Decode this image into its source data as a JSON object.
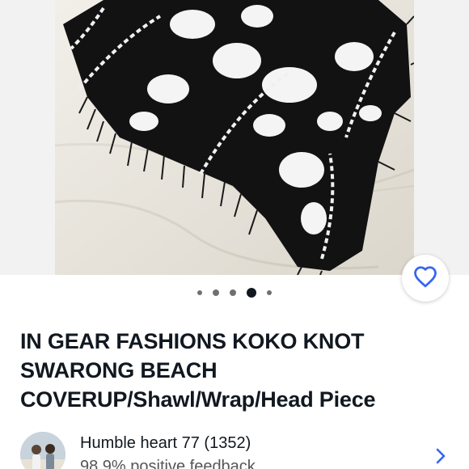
{
  "product": {
    "title": "IN GEAR FASHIONS KOKO KNOT SWARONG BEACH COVERUP/Shawl/Wrap/Head Piece"
  },
  "gallery": {
    "image_count": 5,
    "active_index": 3
  },
  "seller": {
    "name": "Humble heart 77 (1352)",
    "feedback": "98.9% positive feedback"
  },
  "icons": {
    "favorite": "heart-outline-icon",
    "seller_link": "chevron-right-icon"
  },
  "colors": {
    "accent_blue": "#3665f3",
    "text": "#111820",
    "muted": "#555555"
  }
}
